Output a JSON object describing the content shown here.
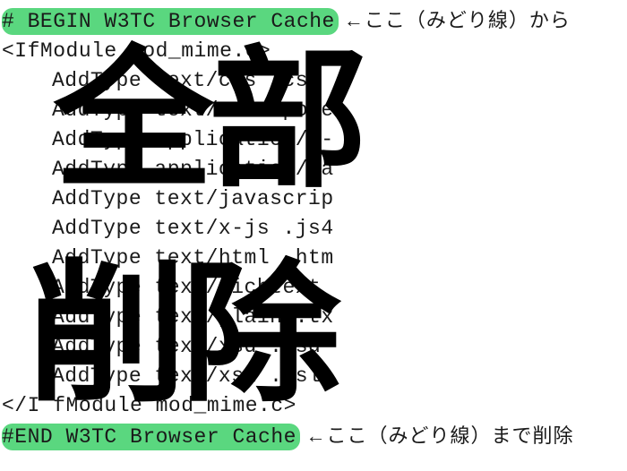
{
  "begin_marker": "# BEGIN W3TC Browser Cache",
  "note_begin_arrow": "←",
  "note_begin_text": "ここ（みどり線）から",
  "ifmodule_open": "<IfModule mod_mime.c>",
  "lines": [
    "AddType text/css .css",
    "AddType text/x-compone",
    "AddType application/x-",
    "AddType application/ja",
    "AddType text/javascrip",
    "AddType text/x-js .js4",
    "AddType text/html .htm",
    "AddType text/richtext",
    "AddType text/plain .tx",
    "AddType text/xsd .xsd",
    "AddType text/xsl .xsl"
  ],
  "ifmodule_close": "</I fModule mod_mime.c>",
  "end_marker": "#END W3TC Browser Cache",
  "note_end_arrow": " ←",
  "note_end_text": "ここ（みどり線）まで削除",
  "overlay_top": "全部",
  "overlay_bottom": "削除",
  "colors": {
    "highlight": "#5ad77f"
  }
}
